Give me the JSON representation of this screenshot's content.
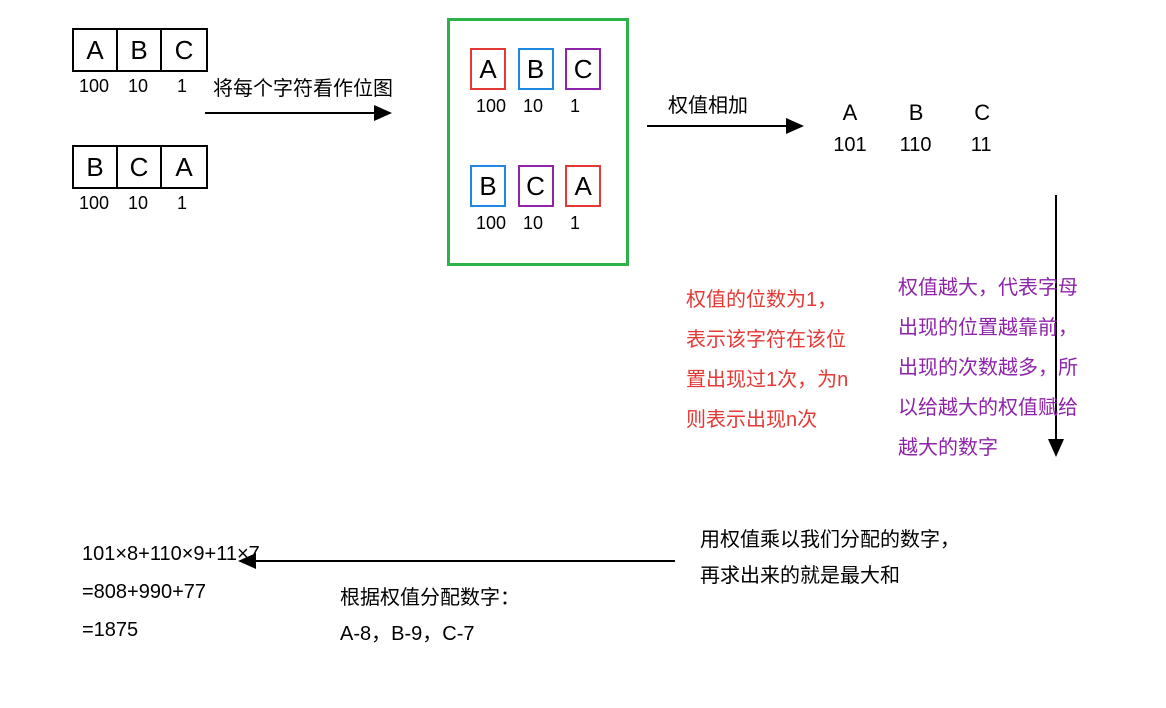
{
  "step1": {
    "row1": {
      "chars": [
        "A",
        "B",
        "C"
      ],
      "vals": [
        "100",
        "10",
        "1"
      ]
    },
    "row2": {
      "chars": [
        "B",
        "C",
        "A"
      ],
      "vals": [
        "100",
        "10",
        "1"
      ]
    }
  },
  "label_treat_as_bitmap": "将每个字符看作位图",
  "step2": {
    "row1": {
      "chars": [
        "A",
        "B",
        "C"
      ],
      "vals": [
        "100",
        "10",
        "1"
      ]
    },
    "row2": {
      "chars": [
        "B",
        "C",
        "A"
      ],
      "vals": [
        "100",
        "10",
        "1"
      ]
    }
  },
  "label_sum_weights": "权值相加",
  "step3": {
    "letters": [
      "A",
      "B",
      "C"
    ],
    "values": [
      "101",
      "110",
      "11"
    ]
  },
  "note_red_l1": "权值的位数为1，",
  "note_red_l2": "表示该字符在该位",
  "note_red_l3": "置出现过1次，为n",
  "note_red_l4": "则表示出现n次",
  "note_purple_l1": "权值越大，代表字母",
  "note_purple_l2": "出现的位置越靠前，",
  "note_purple_l3": "出现的次数越多，所",
  "note_purple_l4": "以给越大的权值赋给",
  "note_purple_l5": "越大的数字",
  "step4_l1": "用权值乘以我们分配的数字，",
  "step4_l2": "再求出来的就是最大和",
  "assign_l1": "根据权值分配数字：",
  "assign_l2": "A-8，B-9，C-7",
  "calc_l1": "101×8+110×9+11×7",
  "calc_l2": "=808+990+77",
  "calc_l3": "=1875"
}
